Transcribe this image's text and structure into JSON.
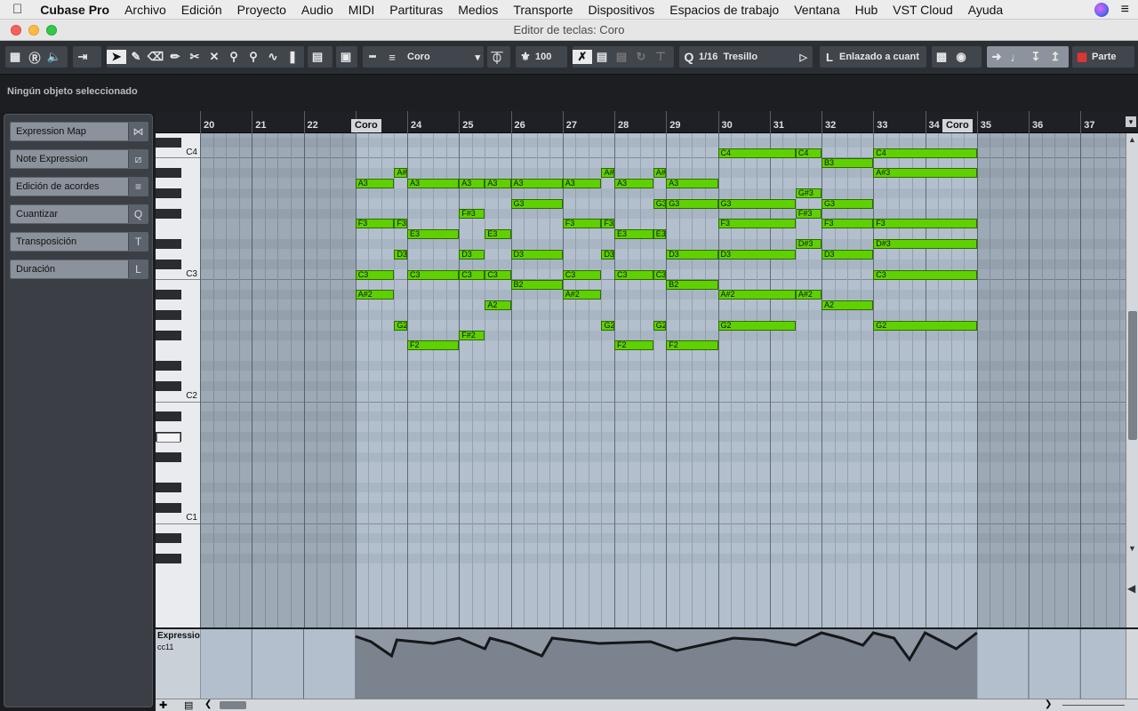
{
  "menubar": {
    "app_name": "Cubase Pro",
    "items": [
      "Archivo",
      "Edición",
      "Proyecto",
      "Audio",
      "MIDI",
      "Partituras",
      "Medios",
      "Transporte",
      "Dispositivos",
      "Espacios de trabajo",
      "Ventana",
      "Hub",
      "VST Cloud",
      "Ayuda"
    ]
  },
  "window": {
    "title": "Editor de teclas: Coro"
  },
  "toolbar": {
    "part_name": "Coro",
    "velocity": "100",
    "quantize": "1/16  Tresillo",
    "quantize_prefix": "Q",
    "length_mode": "Enlazado a cuant",
    "part_label": "Parte"
  },
  "info_line": {
    "text": "Ningún objeto seleccionado"
  },
  "left_zone": {
    "items": [
      {
        "label": "Expression Map",
        "key": "⋈"
      },
      {
        "label": "Note Expression",
        "key": "⧄"
      },
      {
        "label": "Edición de acordes",
        "key": "≡"
      },
      {
        "label": "Cuantizar",
        "key": "Q"
      },
      {
        "label": "Transposición",
        "key": "T"
      },
      {
        "label": "Duración",
        "key": "L"
      }
    ]
  },
  "ruler": {
    "bars": [
      "20",
      "21",
      "22",
      "23",
      "24",
      "25",
      "26",
      "27",
      "28",
      "29",
      "30",
      "31",
      "32",
      "33",
      "34",
      "35",
      "36",
      "37"
    ],
    "markers": [
      "Coro",
      "Coro"
    ]
  },
  "keyboard": {
    "octave_labels": [
      "C4",
      "C3",
      "C2",
      "C1"
    ]
  },
  "notes": [
    {
      "pitch": "C4",
      "bar": 30,
      "len": 1.5
    },
    {
      "pitch": "C4",
      "bar": 31.5,
      "len": 0.5
    },
    {
      "pitch": "C4",
      "bar": 33,
      "len": 2
    },
    {
      "pitch": "B3",
      "bar": 32,
      "len": 1
    },
    {
      "pitch": "A#3",
      "bar": 23.75,
      "len": 0.25
    },
    {
      "pitch": "A#3",
      "bar": 27.75,
      "len": 0.25
    },
    {
      "pitch": "A#3",
      "bar": 28.75,
      "len": 0.25
    },
    {
      "pitch": "A#3",
      "bar": 33,
      "len": 2
    },
    {
      "pitch": "A3",
      "bar": 23,
      "len": 0.75
    },
    {
      "pitch": "A3",
      "bar": 24,
      "len": 1
    },
    {
      "pitch": "A3",
      "bar": 25,
      "len": 0.5
    },
    {
      "pitch": "A3",
      "bar": 25.5,
      "len": 0.5
    },
    {
      "pitch": "A3",
      "bar": 26,
      "len": 1
    },
    {
      "pitch": "A3",
      "bar": 27,
      "len": 0.75
    },
    {
      "pitch": "A3",
      "bar": 28,
      "len": 0.75
    },
    {
      "pitch": "A3",
      "bar": 29,
      "len": 1
    },
    {
      "pitch": "G#3",
      "bar": 31.5,
      "len": 0.5
    },
    {
      "pitch": "G3",
      "bar": 26,
      "len": 1
    },
    {
      "pitch": "G3",
      "bar": 28.75,
      "len": 0.25
    },
    {
      "pitch": "G3",
      "bar": 29,
      "len": 1
    },
    {
      "pitch": "G3",
      "bar": 30,
      "len": 1.5
    },
    {
      "pitch": "G3",
      "bar": 32,
      "len": 1
    },
    {
      "pitch": "F#3",
      "bar": 25,
      "len": 0.5
    },
    {
      "pitch": "F#3",
      "bar": 31.5,
      "len": 0.5
    },
    {
      "pitch": "F3",
      "bar": 23,
      "len": 0.75
    },
    {
      "pitch": "F3",
      "bar": 23.75,
      "len": 0.25
    },
    {
      "pitch": "F3",
      "bar": 27,
      "len": 0.75
    },
    {
      "pitch": "F3",
      "bar": 27.75,
      "len": 0.25
    },
    {
      "pitch": "F3",
      "bar": 30,
      "len": 1.5
    },
    {
      "pitch": "F3",
      "bar": 32,
      "len": 1
    },
    {
      "pitch": "F3",
      "bar": 33,
      "len": 2
    },
    {
      "pitch": "E3",
      "bar": 24,
      "len": 1
    },
    {
      "pitch": "E3",
      "bar": 25.5,
      "len": 0.5
    },
    {
      "pitch": "E3",
      "bar": 28,
      "len": 0.75
    },
    {
      "pitch": "E3",
      "bar": 28.75,
      "len": 0.25
    },
    {
      "pitch": "D#3",
      "bar": 31.5,
      "len": 0.5
    },
    {
      "pitch": "D#3",
      "bar": 33,
      "len": 2
    },
    {
      "pitch": "D3",
      "bar": 23.75,
      "len": 0.25
    },
    {
      "pitch": "D3",
      "bar": 25,
      "len": 0.5
    },
    {
      "pitch": "D3",
      "bar": 26,
      "len": 1
    },
    {
      "pitch": "D3",
      "bar": 27.75,
      "len": 0.25
    },
    {
      "pitch": "D3",
      "bar": 29,
      "len": 1
    },
    {
      "pitch": "D3",
      "bar": 30,
      "len": 1.5
    },
    {
      "pitch": "D3",
      "bar": 32,
      "len": 1
    },
    {
      "pitch": "C3",
      "bar": 23,
      "len": 0.75
    },
    {
      "pitch": "C3",
      "bar": 24,
      "len": 1
    },
    {
      "pitch": "C3",
      "bar": 25,
      "len": 0.5
    },
    {
      "pitch": "C3",
      "bar": 25.5,
      "len": 0.5
    },
    {
      "pitch": "C3",
      "bar": 27,
      "len": 0.75
    },
    {
      "pitch": "C3",
      "bar": 28,
      "len": 0.75
    },
    {
      "pitch": "C3",
      "bar": 28.75,
      "len": 0.25
    },
    {
      "pitch": "C3",
      "bar": 33,
      "len": 2
    },
    {
      "pitch": "B2",
      "bar": 26,
      "len": 1
    },
    {
      "pitch": "B2",
      "bar": 29,
      "len": 1
    },
    {
      "pitch": "A#2",
      "bar": 23,
      "len": 0.75
    },
    {
      "pitch": "A#2",
      "bar": 27,
      "len": 0.75
    },
    {
      "pitch": "A#2",
      "bar": 30,
      "len": 1.5
    },
    {
      "pitch": "A#2",
      "bar": 31.5,
      "len": 0.5
    },
    {
      "pitch": "A2",
      "bar": 25.5,
      "len": 0.5
    },
    {
      "pitch": "A2",
      "bar": 32,
      "len": 1
    },
    {
      "pitch": "G2",
      "bar": 23.75,
      "len": 0.25
    },
    {
      "pitch": "G2",
      "bar": 27.75,
      "len": 0.25
    },
    {
      "pitch": "G2",
      "bar": 28.75,
      "len": 0.25
    },
    {
      "pitch": "G2",
      "bar": 30,
      "len": 1.5
    },
    {
      "pitch": "G2",
      "bar": 33,
      "len": 2
    },
    {
      "pitch": "F#2",
      "bar": 25,
      "len": 0.5
    },
    {
      "pitch": "F2",
      "bar": 24,
      "len": 1
    },
    {
      "pitch": "F2",
      "bar": 28,
      "len": 0.75
    },
    {
      "pitch": "F2",
      "bar": 29,
      "len": 1
    }
  ],
  "controller_lane": {
    "name": "Expressio",
    "cc": "cc11"
  },
  "colors": {
    "note": "#5fd100",
    "grid": "#b3bfcc",
    "background": "#2b2e33"
  }
}
